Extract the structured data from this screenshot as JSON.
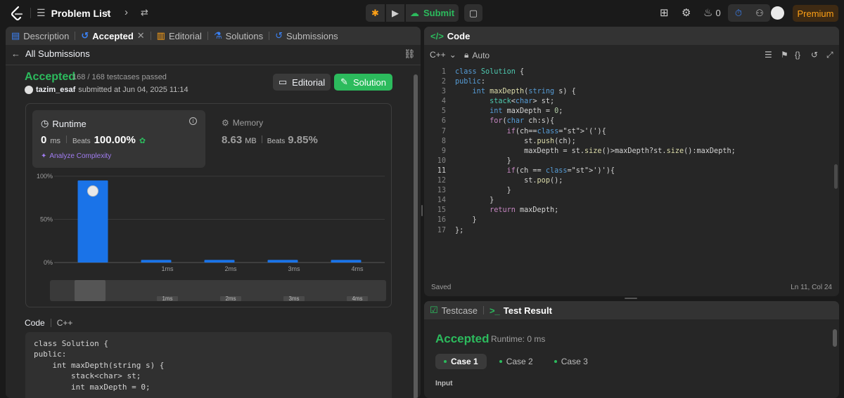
{
  "nav": {
    "problem_list": "Problem List",
    "submit": "Submit",
    "coins": "0",
    "premium": "Premium"
  },
  "left": {
    "tabs": [
      {
        "label": "Description"
      },
      {
        "label": "Accepted"
      },
      {
        "label": "Editorial"
      },
      {
        "label": "Solutions"
      },
      {
        "label": "Submissions"
      }
    ],
    "all_submissions": "All Submissions",
    "status": "Accepted",
    "testcases": "168 / 168 testcases passed",
    "username": "tazim_esaf",
    "submitted_text": "submitted at Jun 04, 2025 11:14",
    "btn_editorial": "Editorial",
    "btn_solution": "Solution",
    "runtime": {
      "label": "Runtime",
      "value": "0",
      "unit": "ms",
      "beats_label": "Beats",
      "beats": "100.00%",
      "analyze": "Analyze Complexity"
    },
    "memory": {
      "label": "Memory",
      "value": "8.63",
      "unit": "MB",
      "beats_label": "Beats",
      "beats": "9.85%"
    },
    "code_label": "Code",
    "code_lang": "C++",
    "code_preview": "class Solution {\npublic:\n    int maxDepth(string s) {\n        stack<char> st;\n        int maxDepth = 0;"
  },
  "chart_data": {
    "type": "bar",
    "categories": [
      "",
      "1ms",
      "2ms",
      "3ms",
      "4ms"
    ],
    "values": [
      95,
      3,
      3,
      3,
      3
    ],
    "yticks": [
      "100%",
      "50%",
      "0%"
    ],
    "ylim": [
      0,
      100
    ],
    "highlight_index": 0,
    "brush_labels": [
      "1ms",
      "2ms",
      "3ms",
      "4ms"
    ]
  },
  "editor": {
    "title": "Code",
    "lang": "C++",
    "mode": "Auto",
    "saved": "Saved",
    "cursor": "Ln 11, Col 24",
    "current_line": 11,
    "lines": [
      "class Solution {",
      "public:",
      "    int maxDepth(string s) {",
      "        stack<char> st;",
      "        int maxDepth = 0;",
      "        for(char ch:s){",
      "            if(ch=='('){",
      "                st.push(ch);",
      "                maxDepth = st.size()>maxDepth?st.size():maxDepth;",
      "            }",
      "            if(ch == ')'){",
      "                st.pop();",
      "            }",
      "        }",
      "        return maxDepth;",
      "    }",
      "};"
    ]
  },
  "result": {
    "tab_testcase": "Testcase",
    "tab_result": "Test Result",
    "status": "Accepted",
    "runtime": "Runtime: 0 ms",
    "cases": [
      "Case 1",
      "Case 2",
      "Case 3"
    ],
    "input_label": "Input"
  }
}
